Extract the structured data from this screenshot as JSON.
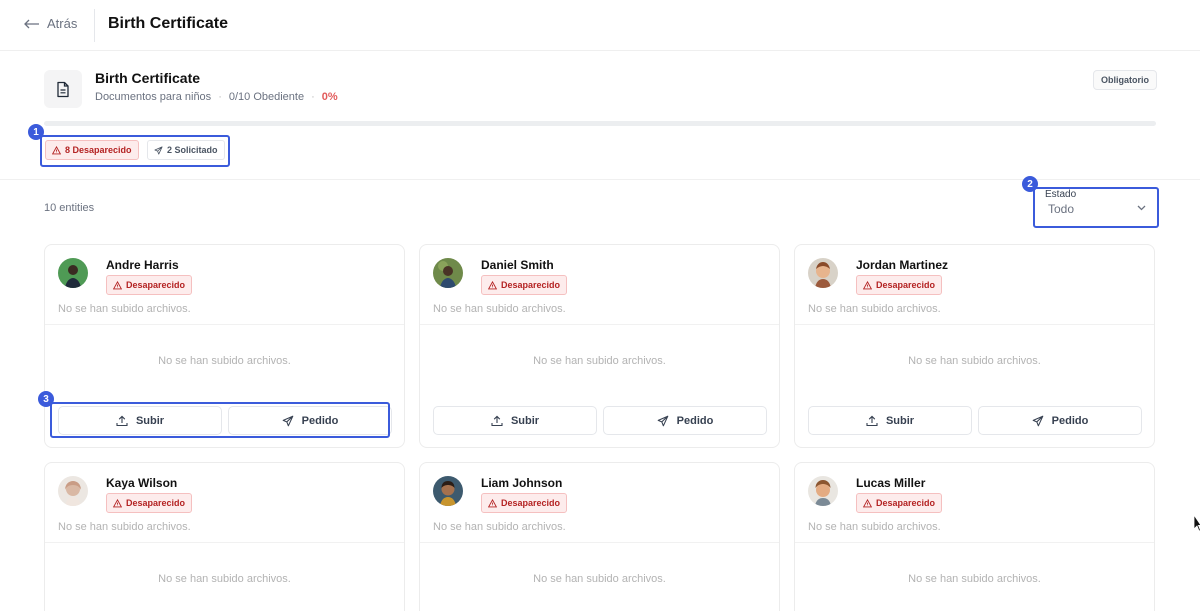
{
  "topbar": {
    "back_label": "Atrás",
    "title": "Birth Certificate"
  },
  "summary": {
    "title": "Birth Certificate",
    "category": "Documentos para niños",
    "compliance": "0/10 Obediente",
    "percent": "0%",
    "progress_fraction": 0,
    "required_badge": "Obligatorio",
    "missing_pill": "8 Desaparecido",
    "requested_pill": "2 Solicitado"
  },
  "list": {
    "entity_count": "10 entities",
    "filter_label": "Estado",
    "filter_value": "Todo"
  },
  "annotations": {
    "one": "1",
    "two": "2",
    "three": "3"
  },
  "cards": [
    {
      "name": "Andre Harris",
      "status": "Desaparecido",
      "no_files_top": "No se han subido archivos.",
      "no_files_mid": "No se han subido archivos.",
      "upload_label": "Subir",
      "request_label": "Pedido"
    },
    {
      "name": "Daniel Smith",
      "status": "Desaparecido",
      "no_files_top": "No se han subido archivos.",
      "no_files_mid": "No se han subido archivos.",
      "upload_label": "Subir",
      "request_label": "Pedido"
    },
    {
      "name": "Jordan Martinez",
      "status": "Desaparecido",
      "no_files_top": "No se han subido archivos.",
      "no_files_mid": "No se han subido archivos.",
      "upload_label": "Subir",
      "request_label": "Pedido"
    },
    {
      "name": "Kaya Wilson",
      "status": "Desaparecido",
      "no_files_top": "No se han subido archivos.",
      "no_files_mid": "No se han subido archivos."
    },
    {
      "name": "Liam Johnson",
      "status": "Desaparecido",
      "no_files_top": "No se han subido archivos.",
      "no_files_mid": "No se han subido archivos."
    },
    {
      "name": "Lucas Miller",
      "status": "Desaparecido",
      "no_files_top": "No se han subido archivos.",
      "no_files_mid": "No se han subido archivos."
    }
  ],
  "colors": {
    "accent": "#3b5bdb",
    "missing": "#b42323",
    "missing_bg": "#fdecec",
    "percent": "#e25b5b"
  },
  "icons": {
    "back": "arrow-left-icon",
    "document": "file-text-icon",
    "warning": "alert-triangle-icon",
    "send": "send-icon",
    "upload": "upload-icon",
    "chevron": "chevron-down-icon"
  }
}
